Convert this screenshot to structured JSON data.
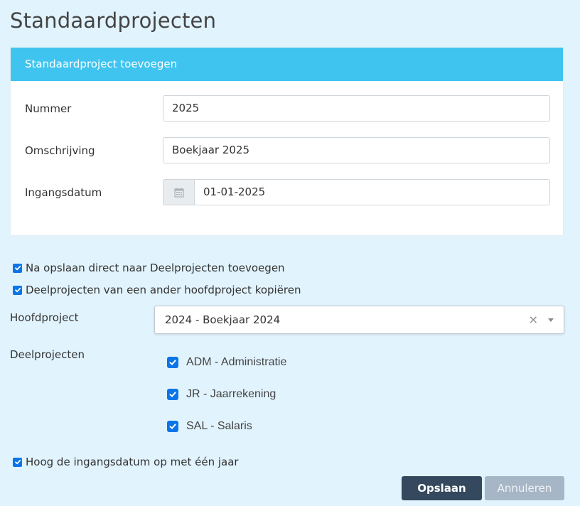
{
  "page": {
    "title": "Standaardprojecten"
  },
  "card": {
    "header": "Standaardproject toevoegen",
    "fields": {
      "nummer": {
        "label": "Nummer",
        "value": "2025"
      },
      "omschrijving": {
        "label": "Omschrijving",
        "value": "Boekjaar 2025"
      },
      "ingangsdatum": {
        "label": "Ingangsdatum",
        "value": "01-01-2025",
        "icon": "calendar-icon"
      }
    }
  },
  "options": {
    "direct_deelprojecten": {
      "label": "Na opslaan direct naar Deelprojecten toevoegen",
      "checked": true
    },
    "kopieren": {
      "label": "Deelprojecten van een ander hoofdproject kopiëren",
      "checked": true
    },
    "ingangsdatum_ophogen": {
      "label": "Hoog de ingangsdatum op met één jaar",
      "checked": true
    }
  },
  "hoofdproject": {
    "label": "Hoofdproject",
    "selected": "2024 - Boekjaar 2024",
    "clear": "×"
  },
  "deelprojecten": {
    "label": "Deelprojecten",
    "items": [
      {
        "label": "ADM - Administratie",
        "checked": true
      },
      {
        "label": "JR - Jaarrekening",
        "checked": true
      },
      {
        "label": "SAL - Salaris",
        "checked": true
      }
    ]
  },
  "actions": {
    "save": "Opslaan",
    "cancel": "Annuleren"
  },
  "colors": {
    "background": "#e1f3fd",
    "card_header": "#3fc4f0",
    "checkbox": "#0a75e8",
    "primary_button": "#34495e",
    "secondary_button": "#a7b6c6"
  }
}
